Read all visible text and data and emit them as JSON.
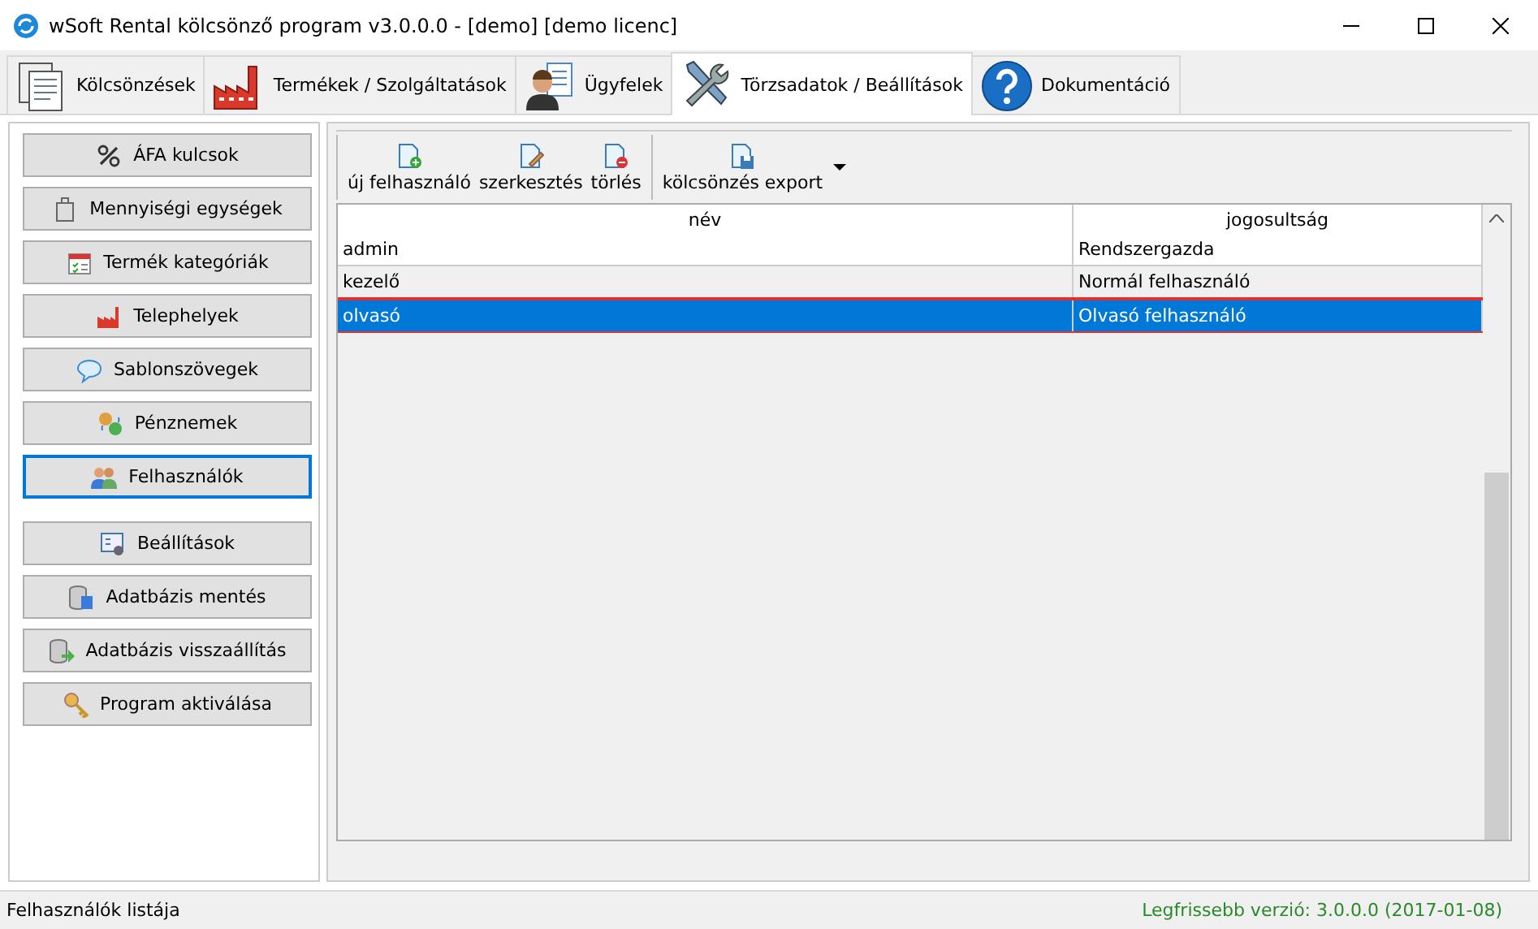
{
  "window": {
    "title": "wSoft Rental kölcsönző program v3.0.0.0 - [demo] [demo licenc]"
  },
  "tabs": [
    {
      "label": "Kölcsönzések",
      "selected": false
    },
    {
      "label": "Termékek / Szolgáltatások",
      "selected": false
    },
    {
      "label": "Ügyfelek",
      "selected": false
    },
    {
      "label": "Törzsadatok / Beállítások",
      "selected": true
    },
    {
      "label": "Dokumentáció",
      "selected": false
    }
  ],
  "sidebar": {
    "groups": [
      [
        {
          "label": "ÁFA kulcsok",
          "selected": false
        },
        {
          "label": "Mennyiségi egységek",
          "selected": false
        },
        {
          "label": "Termék kategóriák",
          "selected": false
        },
        {
          "label": "Telephelyek",
          "selected": false
        },
        {
          "label": "Sablonszövegek",
          "selected": false
        },
        {
          "label": "Pénznemek",
          "selected": false
        },
        {
          "label": "Felhasználók",
          "selected": true
        }
      ],
      [
        {
          "label": "Beállítások",
          "selected": false
        },
        {
          "label": "Adatbázis mentés",
          "selected": false
        },
        {
          "label": "Adatbázis visszaállítás",
          "selected": false
        },
        {
          "label": "Program aktiválása",
          "selected": false
        }
      ]
    ]
  },
  "toolbar": {
    "groups": [
      [
        {
          "label": "új felhasználó",
          "dropdown": false
        },
        {
          "label": "szerkesztés",
          "dropdown": false
        },
        {
          "label": "törlés",
          "dropdown": false
        }
      ],
      [
        {
          "label": "kölcsönzés export",
          "dropdown": true
        }
      ]
    ]
  },
  "table": {
    "columns": [
      "név",
      "jogosultság"
    ],
    "rows": [
      {
        "cells": [
          "admin",
          "Rendszergazda"
        ],
        "selected": false
      },
      {
        "cells": [
          "kezelő",
          "Normál felhasználó"
        ],
        "selected": false
      },
      {
        "cells": [
          "olvasó",
          "Olvasó felhasználó"
        ],
        "selected": true
      }
    ]
  },
  "status_bar": {
    "left": "Felhasználók listája",
    "right": "Legfrissebb verzió: 3.0.0.0 (2017-01-08)"
  }
}
